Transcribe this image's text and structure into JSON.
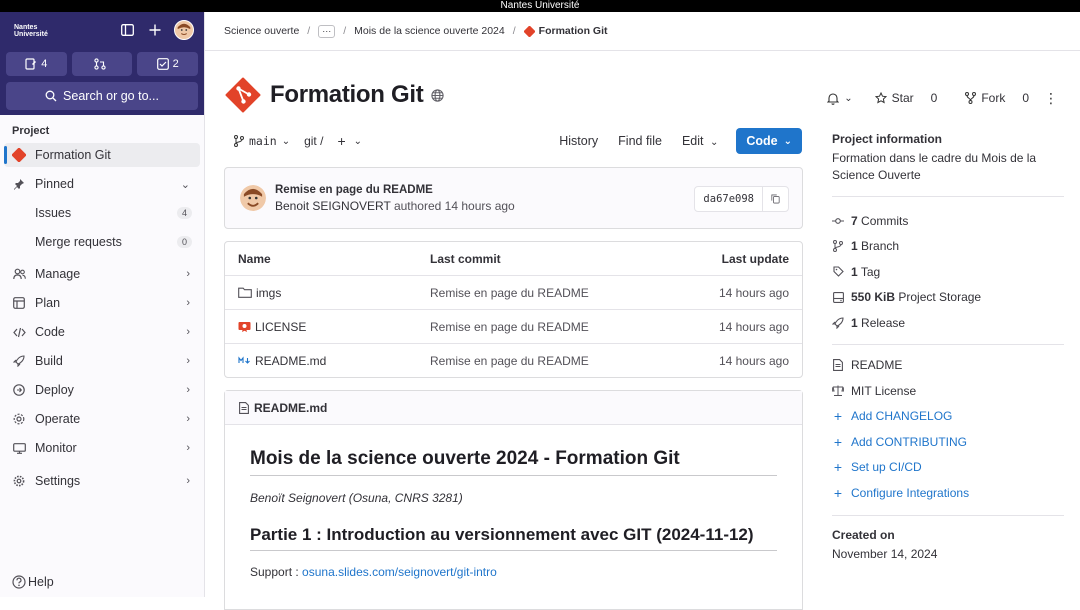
{
  "topbar": {
    "title": "Nantes Université"
  },
  "sidebar": {
    "logo_line1": "Nantes",
    "logo_line2": "Université",
    "counts": {
      "issues": "4",
      "merge_requests": "",
      "todos": "2"
    },
    "search_label": "Search or go to...",
    "section_label": "Project",
    "items": [
      {
        "label": "Formation Git"
      },
      {
        "label": "Pinned"
      },
      {
        "label": "Issues",
        "badge": "4"
      },
      {
        "label": "Merge requests",
        "badge": "0"
      },
      {
        "label": "Manage"
      },
      {
        "label": "Plan"
      },
      {
        "label": "Code"
      },
      {
        "label": "Build"
      },
      {
        "label": "Deploy"
      },
      {
        "label": "Operate"
      },
      {
        "label": "Monitor"
      },
      {
        "label": "Settings"
      }
    ],
    "help_label": "Help"
  },
  "breadcrumb": {
    "items": [
      "Science ouverte",
      "Mois de la science ouverte 2024",
      "Formation Git"
    ]
  },
  "project": {
    "title": "Formation Git",
    "star_label": "Star",
    "star_count": "0",
    "fork_label": "Fork",
    "fork_count": "0"
  },
  "toolbar": {
    "branch": "main",
    "path": "git",
    "path_sep": "/",
    "history": "History",
    "find_file": "Find file",
    "edit": "Edit",
    "code": "Code"
  },
  "commit": {
    "title": "Remise en page du README",
    "author": "Benoit SEIGNOVERT",
    "meta": "authored 14 hours ago",
    "sha": "da67e098"
  },
  "files": {
    "headers": [
      "Name",
      "Last commit",
      "Last update"
    ],
    "rows": [
      {
        "name": "imgs",
        "icon": "folder-icon",
        "commit": "Remise en page du README",
        "updated": "14 hours ago"
      },
      {
        "name": "LICENSE",
        "icon": "license-icon",
        "commit": "Remise en page du README",
        "updated": "14 hours ago"
      },
      {
        "name": "README.md",
        "icon": "markdown-icon",
        "commit": "Remise en page du README",
        "updated": "14 hours ago"
      }
    ]
  },
  "readme": {
    "file": "README.md",
    "h1": "Mois de la science ouverte 2024 - Formation Git",
    "author": "Benoït Seignovert (Osuna, CNRS 3281)",
    "h2": "Partie 1 : Introduction au versionnement avec GIT (2024-11-12)",
    "support_label": "Support :",
    "support_link": "osuna.slides.com/seignovert/git-intro"
  },
  "info": {
    "title": "Project information",
    "description": "Formation dans le cadre du Mois de la Science Ouverte",
    "stats": [
      {
        "bold": "7",
        "text": "Commits"
      },
      {
        "bold": "1",
        "text": "Branch"
      },
      {
        "bold": "1",
        "text": "Tag"
      },
      {
        "bold": "550 KiB",
        "text": "Project Storage"
      },
      {
        "bold": "1",
        "text": "Release"
      }
    ],
    "docs": [
      "README",
      "MIT License"
    ],
    "links": [
      "Add CHANGELOG",
      "Add CONTRIBUTING",
      "Set up CI/CD",
      "Configure Integrations"
    ],
    "created_label": "Created on",
    "created_date": "November 14, 2024"
  },
  "colors": {
    "accent": "#1f75cb",
    "sidebar_top": "#2f2a6b",
    "git_orange": "#e24329"
  }
}
